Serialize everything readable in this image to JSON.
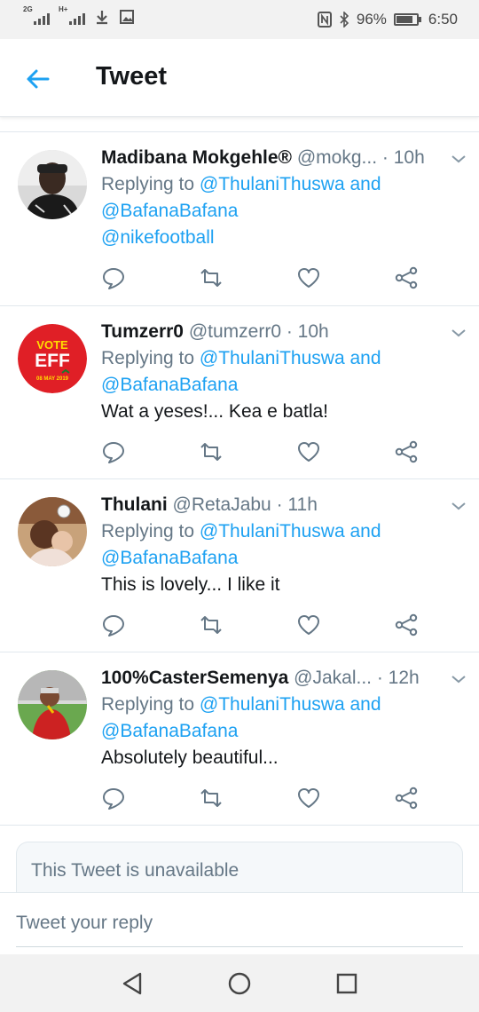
{
  "status_bar": {
    "signal1_label": "2G",
    "signal2_label": "H+",
    "battery_percent": "96%",
    "time": "6:50"
  },
  "header": {
    "title": "Tweet"
  },
  "tweets": [
    {
      "name": "Madibana Mokgehle®",
      "handle": "@mokg...",
      "time": "· 10h",
      "replying_prefix": "Replying to ",
      "reply_user1": "@ThulaniThuswa",
      "reply_and": " and",
      "reply_user2": "@BafanaBafana",
      "reply_user3": "@nikefootball",
      "text": ""
    },
    {
      "name": "Tumzerr0",
      "handle": "@tumzerr0",
      "time": "· 10h",
      "replying_prefix": "Replying to ",
      "reply_user1": "@ThulaniThuswa",
      "reply_and": " and",
      "reply_user2": "@BafanaBafana",
      "text": "Wat a yeses!... Kea e batla!",
      "avatar_text": {
        "line1": "VOTE",
        "line2": "EFF",
        "line3": "08 MAY 2019"
      }
    },
    {
      "name": "Thulani",
      "handle": "@RetaJabu",
      "time": "· 11h",
      "replying_prefix": "Replying to ",
      "reply_user1": "@ThulaniThuswa",
      "reply_and": " and",
      "reply_user2": "@BafanaBafana",
      "text": "This is lovely... I like it"
    },
    {
      "name": "100%CasterSemenya",
      "handle": "@Jakal...",
      "time": "· 12h",
      "replying_prefix": "Replying to ",
      "reply_user1": "@ThulaniThuswa",
      "reply_and": " and",
      "reply_user2": "@BafanaBafana",
      "text": "Absolutely beautiful..."
    }
  ],
  "unavailable_notice": "This Tweet is unavailable",
  "compose": {
    "placeholder": "Tweet your reply"
  },
  "colors": {
    "link": "#1da1f2",
    "secondary_text": "#657786",
    "primary_text": "#14171a",
    "divider": "#e1e8ed",
    "eff_red": "#e01f26"
  },
  "icons": {
    "back": "arrow-left-icon",
    "reply": "comment-icon",
    "retweet": "retweet-icon",
    "like": "heart-icon",
    "share": "share-icon",
    "more": "chevron-down-icon",
    "nav_back": "triangle-back-icon",
    "nav_home": "circle-home-icon",
    "nav_recents": "square-recents-icon"
  }
}
